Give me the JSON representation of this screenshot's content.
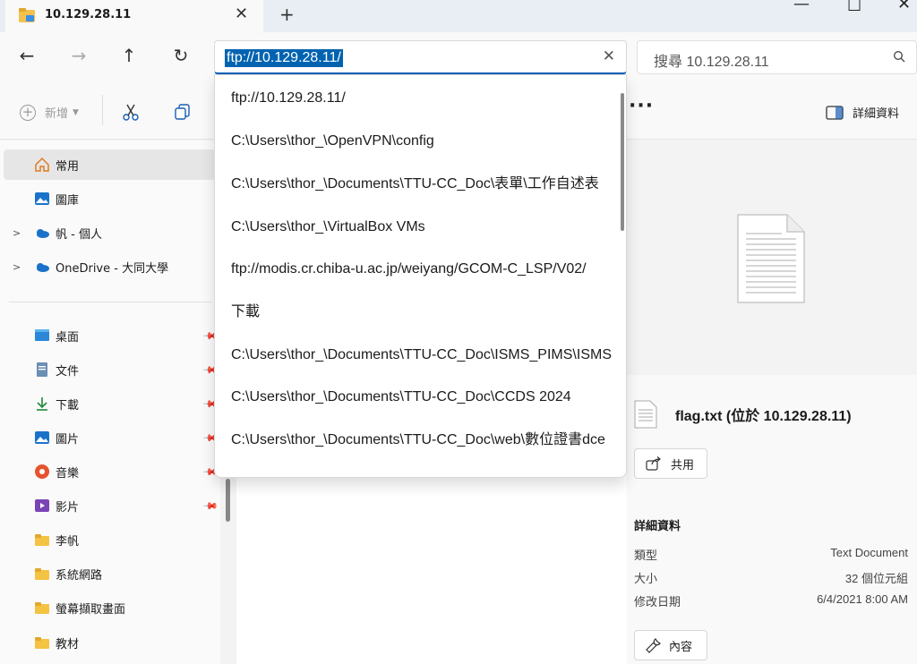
{
  "tab": {
    "title": "10.129.28.11"
  },
  "address": {
    "value": "ftp://10.129.28.11/"
  },
  "search": {
    "placeholder": "搜尋 10.129.28.11"
  },
  "toolbar": {
    "new_label": "新增",
    "details_label": "詳細資料"
  },
  "sidebar": {
    "pinned": [
      {
        "label": "常用",
        "icon": "home-icon"
      },
      {
        "label": "圖庫",
        "icon": "gallery-icon"
      },
      {
        "label": "帆 - 個人",
        "icon": "onedrive-icon"
      },
      {
        "label": "OneDrive - 大同大學",
        "icon": "onedrive-icon"
      }
    ],
    "quick": [
      {
        "label": "桌面",
        "icon": "desktop-icon"
      },
      {
        "label": "文件",
        "icon": "documents-icon"
      },
      {
        "label": "下載",
        "icon": "downloads-icon"
      },
      {
        "label": "圖片",
        "icon": "pictures-icon"
      },
      {
        "label": "音樂",
        "icon": "music-icon"
      },
      {
        "label": "影片",
        "icon": "videos-icon"
      },
      {
        "label": "李帆",
        "icon": "folder-icon"
      },
      {
        "label": "系統網路",
        "icon": "folder-icon"
      },
      {
        "label": "螢幕擷取畫面",
        "icon": "folder-icon"
      },
      {
        "label": "教材",
        "icon": "folder-icon"
      }
    ]
  },
  "dropdown": {
    "items": [
      "ftp://10.129.28.11/",
      "C:\\Users\\thor_\\OpenVPN\\config",
      "C:\\Users\\thor_\\Documents\\TTU-CC_Doc\\表單\\工作自述表",
      "C:\\Users\\thor_\\VirtualBox VMs",
      "ftp://modis.cr.chiba-u.ac.jp/weiyang/GCOM-C_LSP/V02/",
      "下載",
      "C:\\Users\\thor_\\Documents\\TTU-CC_Doc\\ISMS_PIMS\\ISMS",
      "C:\\Users\\thor_\\Documents\\TTU-CC_Doc\\CCDS 2024",
      "C:\\Users\\thor_\\Documents\\TTU-CC_Doc\\web\\數位證書dce"
    ]
  },
  "details": {
    "file_title": "flag.txt (位於 10.129.28.11)",
    "share_label": "共用",
    "heading": "詳細資料",
    "props": [
      {
        "key": "類型",
        "value": "Text Document"
      },
      {
        "key": "大小",
        "value": "32 個位元組"
      },
      {
        "key": "修改日期",
        "value": "6/4/2021 8:00 AM"
      }
    ],
    "properties_label": "內容"
  }
}
